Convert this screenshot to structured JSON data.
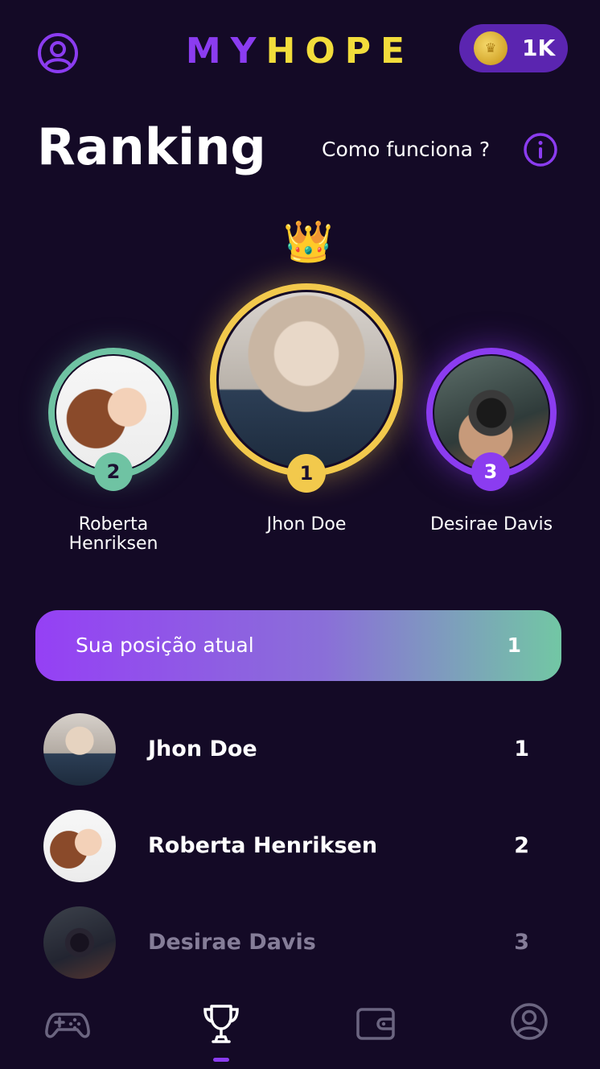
{
  "header": {
    "logo_part1": "MY",
    "logo_part2": "HOPE",
    "coins_label": "1K"
  },
  "page": {
    "title": "Ranking",
    "how_it_works": "Como funciona ?"
  },
  "podium": [
    {
      "name": "Jhon Doe",
      "rank": "1",
      "color": "#f2c94c"
    },
    {
      "name": "Roberta Henriksen",
      "rank": "2",
      "color": "#6fc3a3"
    },
    {
      "name": "Desirae Davis",
      "rank": "3",
      "color": "#8b3cf0"
    }
  ],
  "current_position": {
    "label": "Sua posição atual",
    "value": "1"
  },
  "ranking_list": [
    {
      "name": "Jhon Doe",
      "rank": "1"
    },
    {
      "name": "Roberta Henriksen",
      "rank": "2"
    },
    {
      "name": "Desirae Davis",
      "rank": "3"
    }
  ],
  "bottom_nav": [
    {
      "icon": "gamepad-icon",
      "active": false
    },
    {
      "icon": "trophy-icon",
      "active": true
    },
    {
      "icon": "wallet-icon",
      "active": false
    },
    {
      "icon": "profile-icon",
      "active": false
    }
  ],
  "colors": {
    "background": "#140a26",
    "accent_purple": "#8b3cf0",
    "accent_yellow": "#f2dd3b",
    "gold": "#f2c94c",
    "green": "#6fc3a3",
    "nav_inactive": "#6b6580",
    "nav_active": "#ffffff"
  }
}
